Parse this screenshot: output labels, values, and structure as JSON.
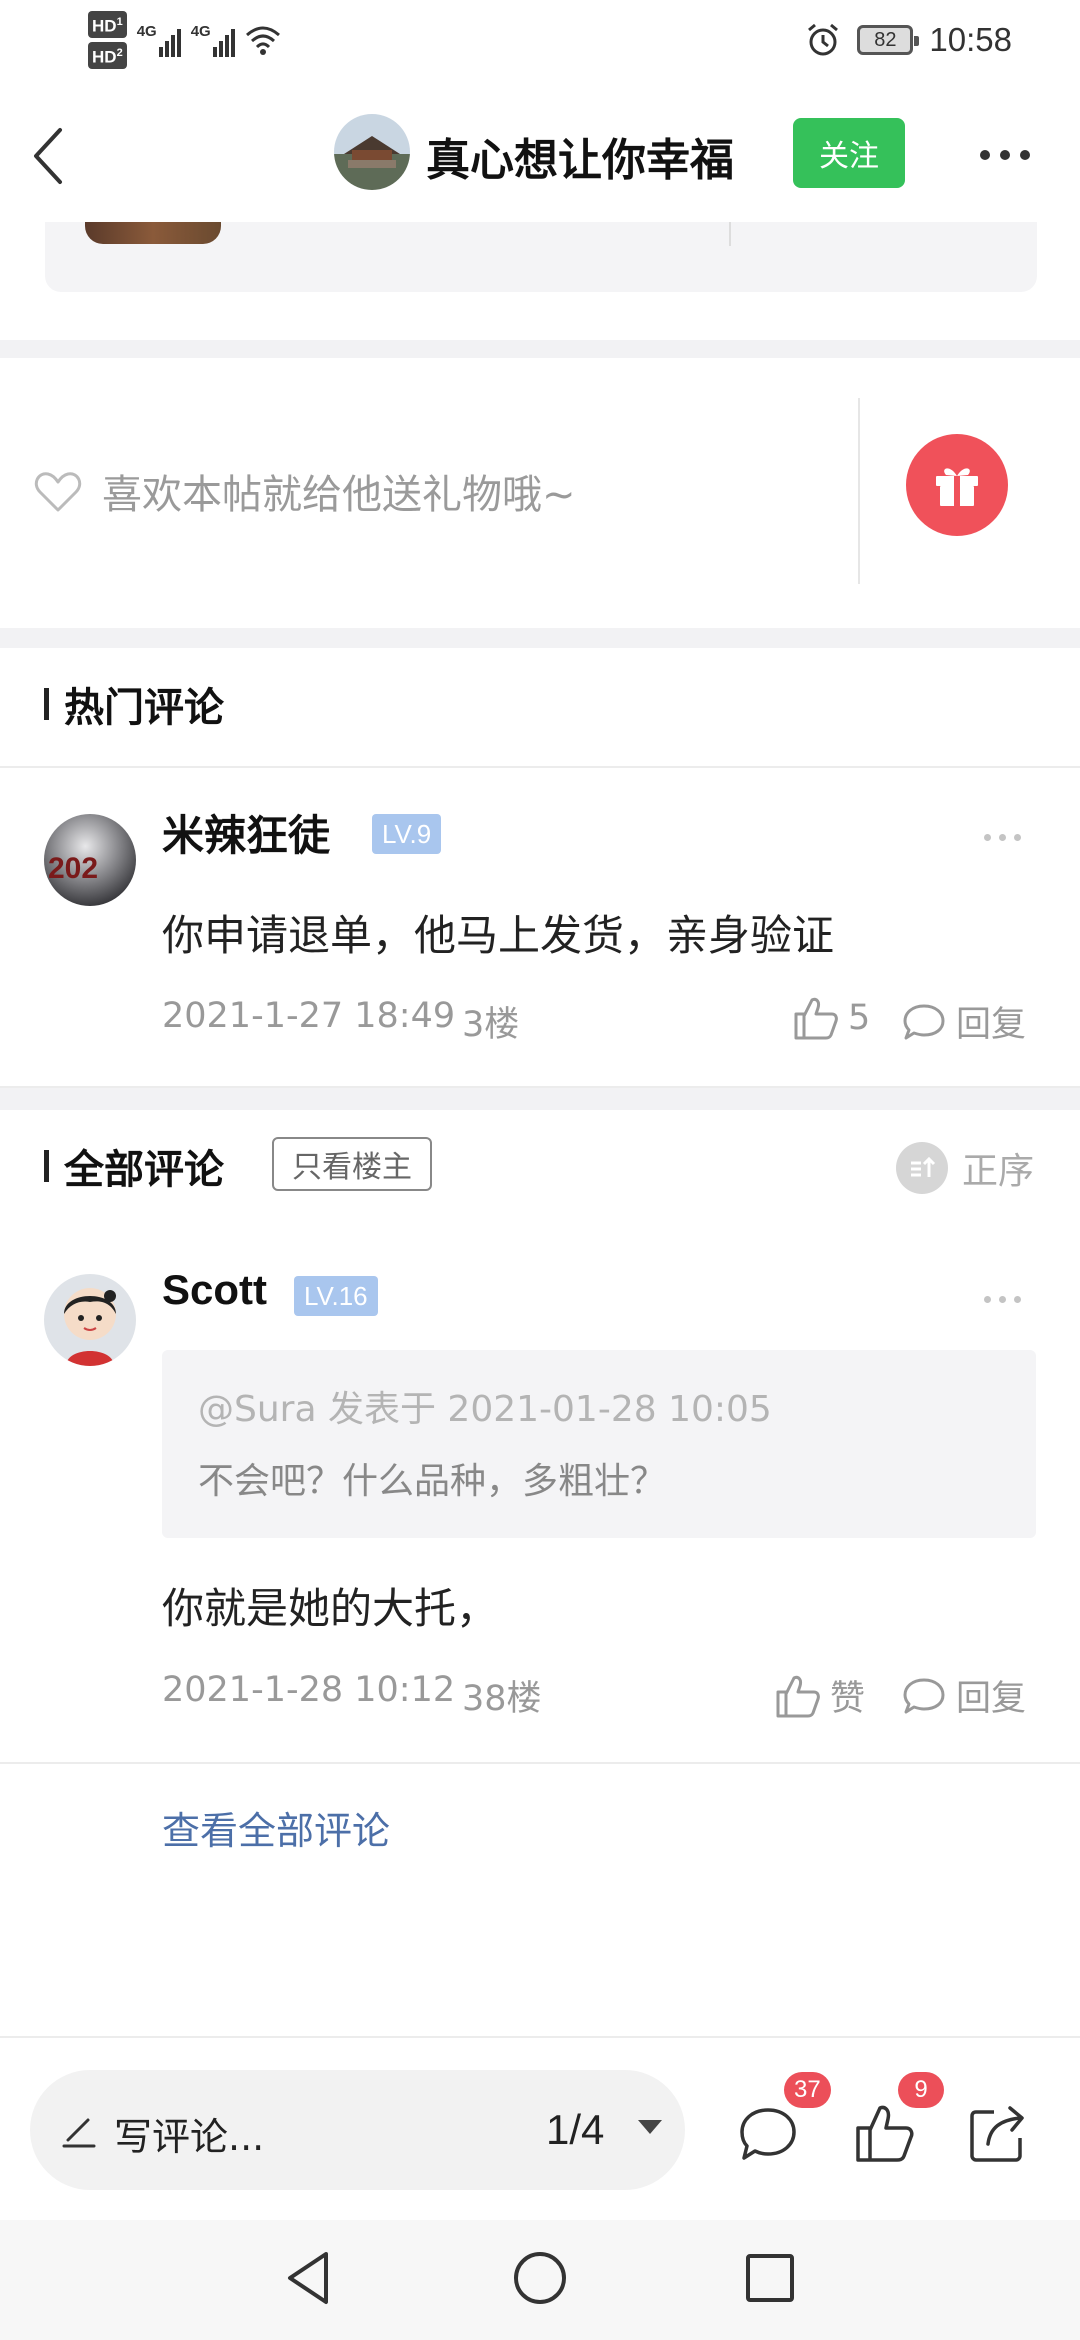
{
  "status_bar": {
    "sim1": "HD",
    "sim1_sub": "1",
    "sim2": "HD",
    "sim2_sub": "2",
    "net1": "4G",
    "net2": "4G",
    "battery": "82",
    "time": "10:58",
    "icons": [
      "signal-icon",
      "wifi-icon",
      "alarm-icon",
      "battery-icon"
    ]
  },
  "header": {
    "title": "真心想让你幸福",
    "follow_label": "关注",
    "icons": [
      "back-icon",
      "more-icon"
    ]
  },
  "gift": {
    "text": "喜欢本帖就给他送礼物哦~",
    "icons": [
      "heart-icon",
      "gift-icon"
    ]
  },
  "hot_comments": {
    "title": "热门评论",
    "items": [
      {
        "name": "米辣狂徒",
        "level": "LV.9",
        "content": "你申请退单，他马上发货，亲身验证",
        "time": "2021-1-27 18:49",
        "floor": "3楼",
        "likes": "5",
        "reply_label": "回复"
      }
    ]
  },
  "all_comments": {
    "title": "全部评论",
    "only_host_label": "只看楼主",
    "order_label": "正序",
    "items": [
      {
        "name": "Scott",
        "level": "LV.16",
        "quote_meta": "@Sura 发表于 2021-01-28 10:05",
        "quote_text": "不会吧？什么品种，多粗壮？",
        "content": "你就是她的大托，",
        "time": "2021-1-28 10:12",
        "floor": "38楼",
        "like_label": "赞",
        "reply_label": "回复"
      }
    ],
    "view_all_label": "查看全部评论"
  },
  "bottom_bar": {
    "write_placeholder": "写评论...",
    "pager": "1/4",
    "comment_count": "37",
    "like_count": "9",
    "icons": [
      "pencil-icon",
      "comment-icon",
      "like-icon",
      "share-icon"
    ]
  },
  "nav_bar": {
    "icons": [
      "nav-back-icon",
      "nav-home-icon",
      "nav-recents-icon"
    ]
  },
  "colors": {
    "accent_green": "#35c15a",
    "badge_red": "#ec4f59",
    "gift_red": "#f0515a",
    "level_blue": "#a9c6ee",
    "link_blue": "#4c6fa8"
  }
}
